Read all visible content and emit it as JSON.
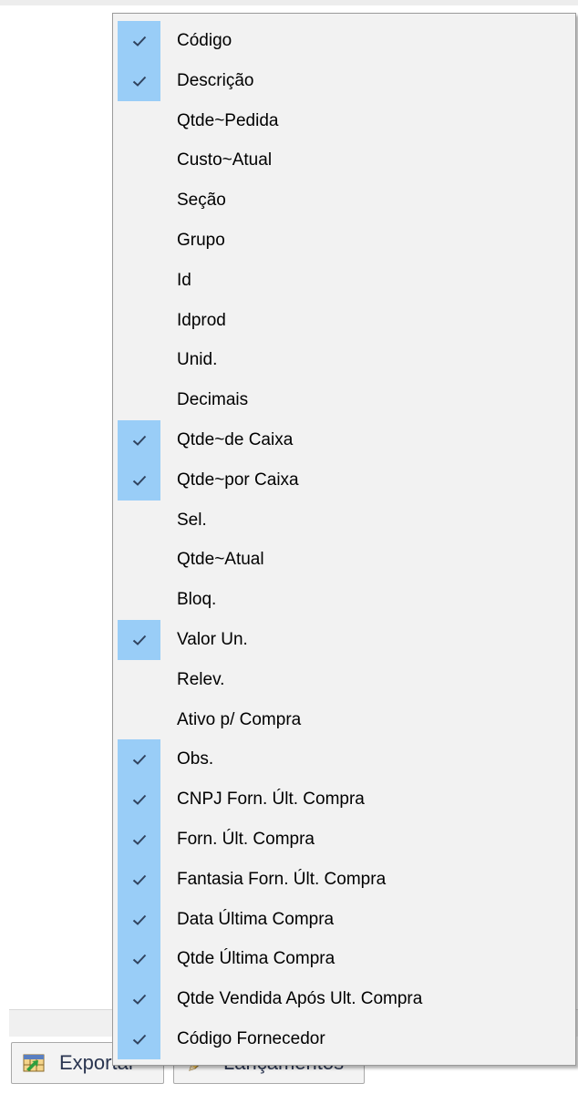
{
  "menu": {
    "items": [
      {
        "label": "Código",
        "checked": true
      },
      {
        "label": "Descrição",
        "checked": true
      },
      {
        "label": "Qtde~Pedida",
        "checked": false
      },
      {
        "label": "Custo~Atual",
        "checked": false
      },
      {
        "label": "Seção",
        "checked": false
      },
      {
        "label": "Grupo",
        "checked": false
      },
      {
        "label": "Id",
        "checked": false
      },
      {
        "label": "Idprod",
        "checked": false
      },
      {
        "label": "Unid.",
        "checked": false
      },
      {
        "label": "Decimais",
        "checked": false
      },
      {
        "label": "Qtde~de Caixa",
        "checked": true
      },
      {
        "label": "Qtde~por Caixa",
        "checked": true
      },
      {
        "label": "Sel.",
        "checked": false
      },
      {
        "label": "Qtde~Atual",
        "checked": false
      },
      {
        "label": "Bloq.",
        "checked": false
      },
      {
        "label": "Valor Un.",
        "checked": true
      },
      {
        "label": "Relev.",
        "checked": false
      },
      {
        "label": "Ativo p/ Compra",
        "checked": false
      },
      {
        "label": "Obs.",
        "checked": true
      },
      {
        "label": "CNPJ Forn. Últ. Compra",
        "checked": true
      },
      {
        "label": "Forn. Últ. Compra",
        "checked": true
      },
      {
        "label": "Fantasia Forn. Últ. Compra",
        "checked": true
      },
      {
        "label": "Data Última Compra",
        "checked": true
      },
      {
        "label": "Qtde Última Compra",
        "checked": true
      },
      {
        "label": "Qtde Vendida Após Ult. Compra",
        "checked": true
      },
      {
        "label": "Código Fornecedor",
        "checked": true
      }
    ]
  },
  "toolbar": {
    "export_label": "Exportar",
    "lancamentos_label": "Lançamentos",
    "export_icon": "spreadsheet-export-icon",
    "lancamentos_icon": "pencil-icon"
  },
  "colors": {
    "check_background": "#99cdf7",
    "menu_background": "#f2f2f2",
    "check_mark": "#30435f"
  }
}
